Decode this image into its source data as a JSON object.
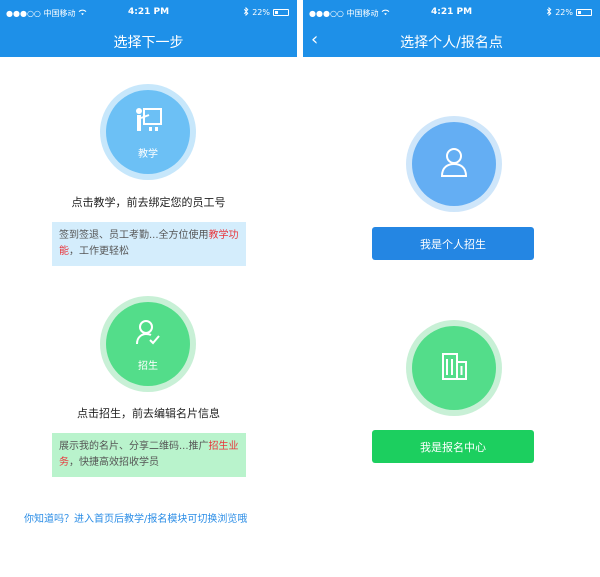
{
  "left": {
    "status": {
      "carrier": "●●●○○ 中国移动 ",
      "time": "4:21 PM",
      "battery": "22%"
    },
    "nav": {
      "title": "选择下一步"
    },
    "teach": {
      "label": "教学",
      "prompt": "点击教学，前去绑定您的员工号",
      "desc_prefix": "签到签退、员工考勤...全方位使用",
      "desc_highlight": "教学功能",
      "desc_suffix": "，工作更轻松"
    },
    "enroll": {
      "label": "招生",
      "prompt": "点击招生，前去编辑名片信息",
      "desc_prefix": "展示我的名片、分享二维码...推广",
      "desc_highlight": "招生业务",
      "desc_suffix": "，快捷高效招收学员"
    },
    "tip": "你知道吗？进入首页后教学/报名模块可切换浏览哦"
  },
  "right": {
    "status": {
      "carrier": "●●●○○ 中国移动 ",
      "time": "4:21 PM",
      "battery": "22%"
    },
    "nav": {
      "title": "选择个人/报名点",
      "back": "‹"
    },
    "personal_button": "我是个人招生",
    "center_button": "我是报名中心"
  },
  "colors": {
    "nav_blue": "#1e90e8",
    "teach_blue": "#6cc0f5",
    "enroll_green": "#53dd8a",
    "highlight_red": "#e8363c",
    "personal_btn": "#2486e3",
    "center_btn": "#1ccf5f"
  },
  "icons": {
    "teach": "whiteboard-teacher-icon",
    "enroll": "person-check-icon",
    "personal": "person-outline-icon",
    "center": "building-icon",
    "back": "chevron-left-icon",
    "wifi": "wifi-icon",
    "bluetooth": "bluetooth-icon",
    "battery": "battery-icon"
  }
}
